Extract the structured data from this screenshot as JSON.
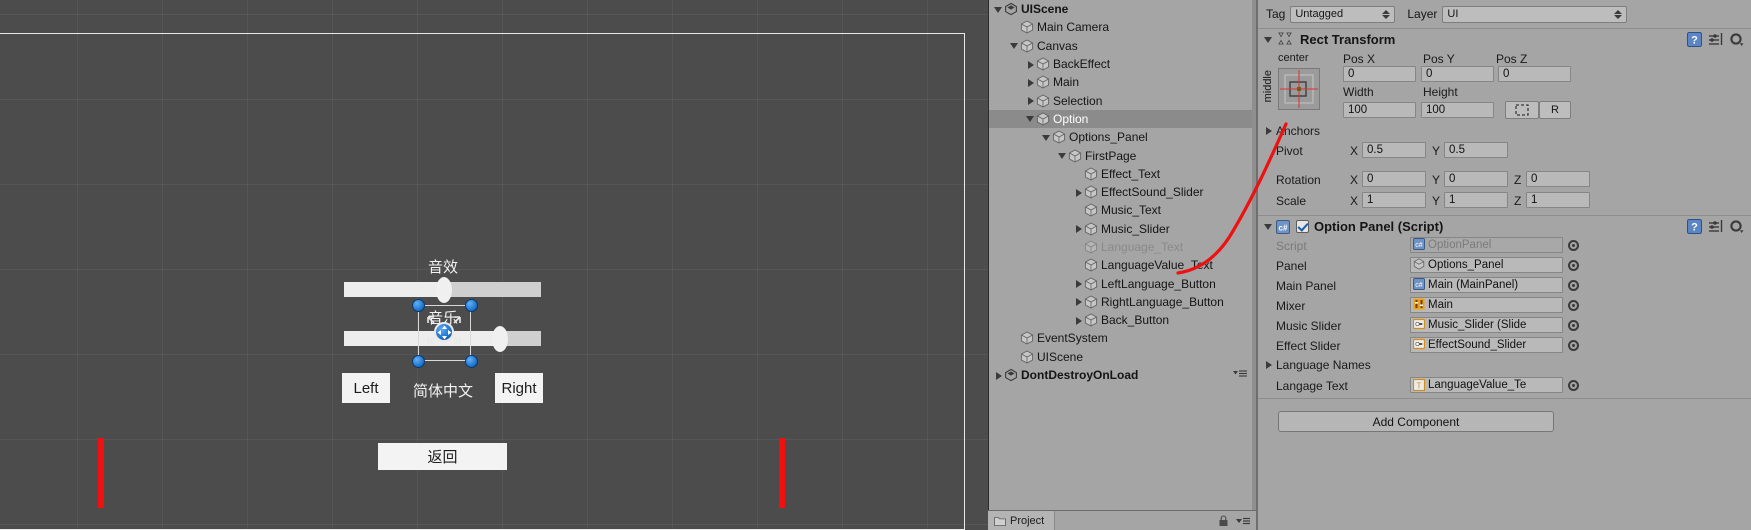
{
  "scene": {
    "ui_labels": {
      "effect_text": "音效",
      "music_text": "音乐",
      "language_value_text": "简体中文",
      "left_button": "Left",
      "right_button": "Right",
      "back_button": "返回"
    },
    "sliders": [
      {
        "name": "EffectSound_Slider",
        "value_pct": 51
      },
      {
        "name": "Music_Slider",
        "value_pct": 79
      }
    ]
  },
  "hierarchy": {
    "rows": [
      {
        "label": "UIScene",
        "depth": 0,
        "tri": "open",
        "icon": "unity",
        "state": "normal",
        "bold": true
      },
      {
        "label": "Main Camera",
        "depth": 1,
        "tri": "none",
        "icon": "go",
        "state": "normal"
      },
      {
        "label": "Canvas",
        "depth": 1,
        "tri": "open",
        "icon": "go",
        "state": "normal"
      },
      {
        "label": "BackEffect",
        "depth": 2,
        "tri": "closed",
        "icon": "go",
        "state": "normal"
      },
      {
        "label": "Main",
        "depth": 2,
        "tri": "closed",
        "icon": "go",
        "state": "normal"
      },
      {
        "label": "Selection",
        "depth": 2,
        "tri": "closed",
        "icon": "go",
        "state": "normal"
      },
      {
        "label": "Option",
        "depth": 2,
        "tri": "open",
        "icon": "go",
        "state": "selected"
      },
      {
        "label": "Options_Panel",
        "depth": 3,
        "tri": "open",
        "icon": "go",
        "state": "normal"
      },
      {
        "label": "FirstPage",
        "depth": 4,
        "tri": "open",
        "icon": "go",
        "state": "normal"
      },
      {
        "label": "Effect_Text",
        "depth": 5,
        "tri": "none",
        "icon": "go",
        "state": "normal"
      },
      {
        "label": "EffectSound_Slider",
        "depth": 5,
        "tri": "closed",
        "icon": "go",
        "state": "normal"
      },
      {
        "label": "Music_Text",
        "depth": 5,
        "tri": "none",
        "icon": "go",
        "state": "normal"
      },
      {
        "label": "Music_Slider",
        "depth": 5,
        "tri": "closed",
        "icon": "go",
        "state": "normal"
      },
      {
        "label": "Language_Text",
        "depth": 5,
        "tri": "none",
        "icon": "go",
        "state": "dim"
      },
      {
        "label": "LanguageValue_Text",
        "depth": 5,
        "tri": "none",
        "icon": "go",
        "state": "normal"
      },
      {
        "label": "LeftLanguage_Button",
        "depth": 5,
        "tri": "closed",
        "icon": "go",
        "state": "normal"
      },
      {
        "label": "RightLanguage_Button",
        "depth": 5,
        "tri": "closed",
        "icon": "go",
        "state": "normal"
      },
      {
        "label": "Back_Button",
        "depth": 5,
        "tri": "closed",
        "icon": "go",
        "state": "normal"
      },
      {
        "label": "EventSystem",
        "depth": 1,
        "tri": "none",
        "icon": "go",
        "state": "normal"
      },
      {
        "label": "UIScene",
        "depth": 1,
        "tri": "none",
        "icon": "go",
        "state": "normal"
      },
      {
        "label": "DontDestroyOnLoad",
        "depth": 0,
        "tri": "closed",
        "icon": "unity",
        "state": "normal",
        "bold": true,
        "has_menu": true
      }
    ]
  },
  "project_tab": {
    "label": "Project"
  },
  "inspector": {
    "tag_label": "Tag",
    "tag_value": "Untagged",
    "layer_label": "Layer",
    "layer_value": "UI",
    "rect_transform": {
      "title": "Rect Transform",
      "anchor_preset_h": "center",
      "anchor_preset_v": "middle",
      "pos_x_label": "Pos X",
      "pos_x": "0",
      "pos_y_label": "Pos Y",
      "pos_y": "0",
      "pos_z_label": "Pos Z",
      "pos_z": "0",
      "width_label": "Width",
      "width": "100",
      "height_label": "Height",
      "height": "100",
      "blueprint_label": "",
      "raw_label": "R",
      "anchors_label": "Anchors",
      "pivot_label": "Pivot",
      "pivot_x": "0.5",
      "pivot_y": "0.5",
      "rotation_label": "Rotation",
      "rot_x": "0",
      "rot_y": "0",
      "rot_z": "0",
      "scale_label": "Scale",
      "scale_x": "1",
      "scale_y": "1",
      "scale_z": "1",
      "axis_x": "X",
      "axis_y": "Y",
      "axis_z": "Z"
    },
    "option_panel": {
      "title": "Option Panel (Script)",
      "rows": [
        {
          "label": "Script",
          "value": "OptionPanel",
          "icon": "script",
          "dim": true
        },
        {
          "label": "Panel",
          "value": "Options_Panel",
          "icon": "go",
          "dim": false
        },
        {
          "label": "Main Panel",
          "value": "Main (MainPanel)",
          "icon": "script",
          "dim": false
        },
        {
          "label": "Mixer",
          "value": "Main",
          "icon": "mixer",
          "dim": false
        },
        {
          "label": "Music Slider",
          "value": "Music_Slider (Slide",
          "icon": "slider",
          "dim": false
        },
        {
          "label": "Effect Slider",
          "value": "EffectSound_Slider",
          "icon": "slider",
          "dim": false
        }
      ],
      "language_names_label": "Language Names",
      "langage_text_label": "Langage Text",
      "langage_text_value": "LanguageValue_Te"
    },
    "add_component_label": "Add Component"
  },
  "colors": {
    "panel_bg": "#a5a5a5",
    "scene_bg": "#4c4c4c",
    "selection_blue": "#1f77d0",
    "annotation_red": "#f01010"
  }
}
